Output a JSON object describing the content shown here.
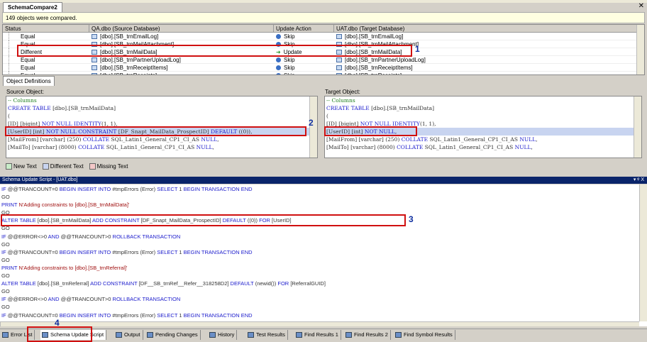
{
  "document_tab": "SchemaCompare2",
  "info_text": "149 objects were compared.",
  "grid": {
    "headers": [
      "Status",
      "QA.dbo (Source Database)",
      "Update Action",
      "UAT.dbo (Target Database)"
    ],
    "rows": [
      {
        "status": "Equal",
        "source": "[dbo].[SB_trnEmailLog]",
        "action": "Skip",
        "target": "[dbo].[SB_trnEmailLog]"
      },
      {
        "status": "Equal",
        "source": "[dbo].[SB_trnMailAttachment]",
        "action": "Skip",
        "target": "[dbo].[SB_trnMailAttachment]"
      },
      {
        "status": "Different",
        "source": "[dbo].[SB_trnMailData]",
        "action": "Update",
        "target": "[dbo].[SB_trnMailData]"
      },
      {
        "status": "Equal",
        "source": "[dbo].[SB_trnPartnerUploadLog]",
        "action": "Skip",
        "target": "[dbo].[SB_trnPartnerUploadLog]"
      },
      {
        "status": "Equal",
        "source": "[dbo].[SB_trnReceiptItems]",
        "action": "Skip",
        "target": "[dbo].[SB_trnReceiptItems]"
      },
      {
        "status": "Equal",
        "source": "[dbo].[SB_trnReceipts]",
        "action": "Skip",
        "target": "[dbo].[SB_trnReceipts]"
      }
    ]
  },
  "object_definitions_tab": "Object Definitions",
  "source_label": "Source Object:",
  "target_label": "Target Object:",
  "source_code": [
    [
      [
        "cm",
        "-- Columns"
      ]
    ],
    [
      [
        "kw",
        "CREATE TABLE"
      ],
      [
        "tx",
        " [dbo].[SB_trnMailData]"
      ]
    ],
    [
      [
        "tx",
        "("
      ]
    ],
    [
      [
        "tx",
        "[ID] [bigint] "
      ],
      [
        "kw",
        "NOT NULL IDENTITY"
      ],
      [
        "tx",
        "(1, 1),"
      ]
    ],
    [
      [
        "tx",
        "[UserID] [int] "
      ],
      [
        "kw",
        "NOT NULL CONSTRAINT"
      ],
      [
        "tx",
        " [DF_Snapt_MailData_ProspectID] "
      ],
      [
        "kw",
        "DEFAULT"
      ],
      [
        "tx",
        " ((0)),"
      ]
    ],
    [
      [
        "tx",
        "[MailFrom] [varchar] (250) "
      ],
      [
        "kw",
        "COLLATE"
      ],
      [
        "tx",
        " SQL_Latin1_General_CP1_CI_AS "
      ],
      [
        "kw",
        "NULL"
      ],
      [
        "tx",
        ","
      ]
    ],
    [
      [
        "tx",
        "[MailTo] [varchar] (8000) "
      ],
      [
        "kw",
        "COLLATE"
      ],
      [
        "tx",
        " SQL_Latin1_General_CP1_CI_AS "
      ],
      [
        "kw",
        "NULL"
      ],
      [
        "tx",
        ","
      ]
    ]
  ],
  "target_code": [
    [
      [
        "cm",
        "-- Columns"
      ]
    ],
    [
      [
        "kw",
        "CREATE TABLE"
      ],
      [
        "tx",
        " [dbo].[SB_trnMailData]"
      ]
    ],
    [
      [
        "tx",
        "("
      ]
    ],
    [
      [
        "tx",
        "[ID] [bigint] "
      ],
      [
        "kw",
        "NOT NULL IDENTITY"
      ],
      [
        "tx",
        "(1, 1),"
      ]
    ],
    [
      [
        "tx",
        "[UserID] [int] "
      ],
      [
        "kw",
        "NOT NULL"
      ],
      [
        "tx",
        ","
      ]
    ],
    [
      [
        "tx",
        "[MailFrom] [varchar] (250) "
      ],
      [
        "kw",
        "COLLATE"
      ],
      [
        "tx",
        " SQL_Latin1_General_CP1_CI_AS "
      ],
      [
        "kw",
        "NULL"
      ],
      [
        "tx",
        ","
      ]
    ],
    [
      [
        "tx",
        "[MailTo] [varchar] (8000) "
      ],
      [
        "kw",
        "COLLATE"
      ],
      [
        "tx",
        " SQL_Latin1_General_CP1_CI_AS "
      ],
      [
        "kw",
        "NULL"
      ],
      [
        "tx",
        ","
      ]
    ]
  ],
  "legend": [
    {
      "label": "New Text",
      "color": "#c8ecc8"
    },
    {
      "label": "Different Text",
      "color": "#c8d4f0"
    },
    {
      "label": "Missing Text",
      "color": "#f4c8c8"
    }
  ],
  "script_title": "Schema Update Script - [UAT.dbo]",
  "script_code": [
    [
      [
        "kw",
        "IF"
      ],
      [
        "tx",
        " @@TRANCOUNT=0 "
      ],
      [
        "kw",
        "BEGIN INSERT INTO"
      ],
      [
        "tx",
        " #tmpErrors (Error) "
      ],
      [
        "kw",
        "SELECT"
      ],
      [
        "tx",
        " 1 "
      ],
      [
        "kw",
        "BEGIN TRANSACTION END"
      ]
    ],
    [
      [
        "tx",
        "GO"
      ]
    ],
    [
      [
        "kw",
        "PRINT"
      ],
      [
        "tx",
        " "
      ],
      [
        "str",
        "N'Adding constraints to [dbo].[SB_trnMailData]'"
      ]
    ],
    [
      [
        "tx",
        "GO"
      ]
    ],
    [
      [
        "kw",
        "ALTER TABLE"
      ],
      [
        "tx",
        " [dbo].[SB_trnMailData] "
      ],
      [
        "kw",
        "ADD CONSTRAINT"
      ],
      [
        "tx",
        " [DF_Snapt_MailData_ProspectID] "
      ],
      [
        "kw",
        "DEFAULT"
      ],
      [
        "tx",
        " ((0)) "
      ],
      [
        "kw",
        "FOR"
      ],
      [
        "tx",
        " [UserID]"
      ]
    ],
    [
      [
        "tx",
        "GO"
      ]
    ],
    [
      [
        "kw",
        "IF"
      ],
      [
        "tx",
        " @@ERROR<>0 "
      ],
      [
        "kw",
        "AND"
      ],
      [
        "tx",
        " @@TRANCOUNT>0 "
      ],
      [
        "kw",
        "ROLLBACK TRANSACTION"
      ]
    ],
    [
      [
        "tx",
        "GO"
      ]
    ],
    [
      [
        "kw",
        "IF"
      ],
      [
        "tx",
        " @@TRANCOUNT=0 "
      ],
      [
        "kw",
        "BEGIN INSERT INTO"
      ],
      [
        "tx",
        " #tmpErrors (Error) "
      ],
      [
        "kw",
        "SELECT"
      ],
      [
        "tx",
        " 1 "
      ],
      [
        "kw",
        "BEGIN TRANSACTION END"
      ]
    ],
    [
      [
        "tx",
        "GO"
      ]
    ],
    [
      [
        "kw",
        "PRINT"
      ],
      [
        "tx",
        " "
      ],
      [
        "str",
        "N'Adding constraints to [dbo].[SB_trnReferral]'"
      ]
    ],
    [
      [
        "tx",
        "GO"
      ]
    ],
    [
      [
        "kw",
        "ALTER TABLE"
      ],
      [
        "tx",
        " [dbo].[SB_trnReferral] "
      ],
      [
        "kw",
        "ADD CONSTRAINT"
      ],
      [
        "tx",
        " [DF__SB_trnRef__Refer__318258D2] "
      ],
      [
        "kw",
        "DEFAULT"
      ],
      [
        "tx",
        " (newid()) "
      ],
      [
        "kw",
        "FOR"
      ],
      [
        "tx",
        " [ReferralGUID]"
      ]
    ],
    [
      [
        "tx",
        "GO"
      ]
    ],
    [
      [
        "kw",
        "IF"
      ],
      [
        "tx",
        " @@ERROR<>0 "
      ],
      [
        "kw",
        "AND"
      ],
      [
        "tx",
        " @@TRANCOUNT>0 "
      ],
      [
        "kw",
        "ROLLBACK TRANSACTION"
      ]
    ],
    [
      [
        "tx",
        "GO"
      ]
    ],
    [
      [
        "kw",
        "IF"
      ],
      [
        "tx",
        " @@TRANCOUNT=0 "
      ],
      [
        "kw",
        "BEGIN INSERT INTO"
      ],
      [
        "tx",
        " #tmpErrors (Error) "
      ],
      [
        "kw",
        "SELECT"
      ],
      [
        "tx",
        " 1 "
      ],
      [
        "kw",
        "BEGIN TRANSACTION END"
      ]
    ]
  ],
  "bottom_tabs": [
    "Error List",
    "Schema Update Script",
    "Output",
    "Pending Changes",
    "History",
    "Test Results",
    "Find Results 1",
    "Find Results 2",
    "Find Symbol Results"
  ],
  "annotations": [
    "1",
    "2",
    "3",
    "4"
  ],
  "panel_controls": "▾ ᵠ X"
}
